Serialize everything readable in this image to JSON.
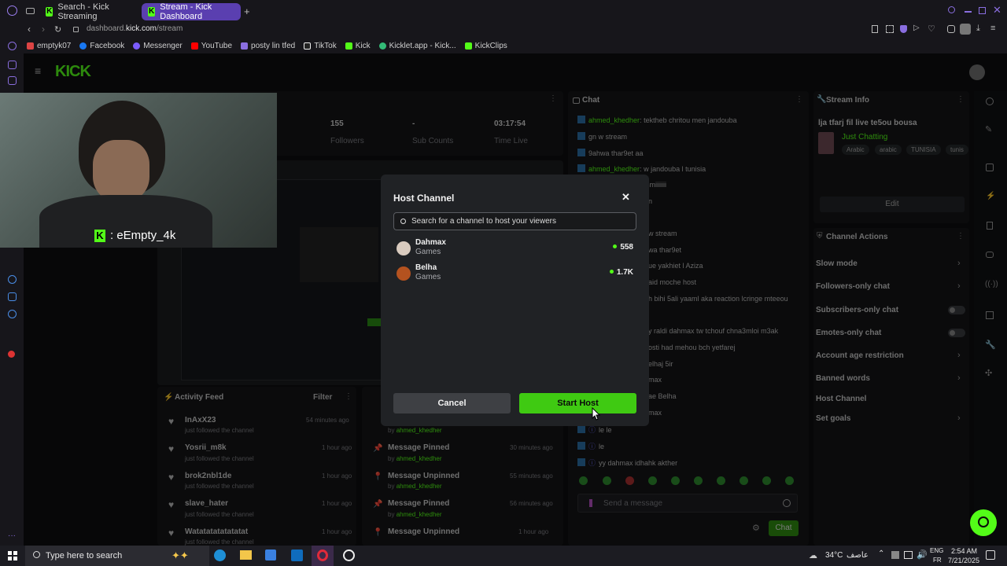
{
  "browser": {
    "tabs": [
      {
        "label": "Search - Kick Streaming",
        "active": false
      },
      {
        "label": "Stream - Kick Dashboard",
        "active": true
      }
    ],
    "url_host": "dashboard.",
    "url_domain": "kick.com",
    "url_path": "/stream",
    "bookmarks": [
      "emptyk07",
      "Facebook",
      "Messenger",
      "YouTube",
      "posty lin tfed",
      "TikTok",
      "Kick",
      "Kicklet.app - Kick...",
      "KickClips"
    ]
  },
  "dashboard": {
    "logo": "KICK",
    "stats": [
      {
        "value": "155",
        "label": "Followers"
      },
      {
        "value": "-",
        "label": "Sub Counts"
      },
      {
        "value": "03:17:54",
        "label": "Time Live"
      }
    ],
    "webcam_overlay": ": eEmpty_4k",
    "chat": {
      "title": "Chat",
      "lines": [
        {
          "user": "ahmed_khedher",
          "text": "tektheb chritou men jandouba"
        },
        {
          "user": "",
          "text": "gn w stream"
        },
        {
          "user": "",
          "text": "9ahwa thar9et aa"
        },
        {
          "user": "ahmed_khedher",
          "text": "w jandouba l tunisia"
        },
        {
          "user": "",
          "text": "rsmiiiiiii"
        },
        {
          "user": "",
          "text": "n"
        },
        {
          "user": "",
          "text": "w stream"
        },
        {
          "user": "",
          "text": "wa thar9et"
        },
        {
          "user": "",
          "text": "ue yakhiet l Aziza"
        },
        {
          "user": "",
          "text": "aid moche host"
        },
        {
          "user": "",
          "text": "h bihi 5ali yaaml aka reaction lcringe mteeou"
        },
        {
          "user": "",
          "text": "y raldi dahmax tw tchouf chna3mloi m3ak"
        },
        {
          "user": "",
          "text": "osti had mehou bch yetfarej"
        },
        {
          "user": "",
          "text": "elhaj 5ir"
        },
        {
          "user": "",
          "text": "max"
        },
        {
          "user": "",
          "text": "ae Belha"
        },
        {
          "user": "",
          "text": "max"
        },
        {
          "user": "",
          "text": "le le"
        },
        {
          "user": "",
          "text": "le"
        },
        {
          "user": "",
          "text": "yy dahmax idhahk akther"
        }
      ],
      "input_placeholder": "Send a message",
      "send_label": "Chat"
    },
    "stream_info": {
      "title": "Stream Info",
      "stream_title": "lja tfarj fil live te5ou bousa",
      "category": "Just Chatting",
      "tags": [
        "Arabic",
        "arabic",
        "TUNISIA",
        "tunis"
      ],
      "edit_label": "Edit"
    },
    "channel_actions": {
      "title": "Channel Actions",
      "items": [
        {
          "label": "Slow mode",
          "kind": "chevron"
        },
        {
          "label": "Followers-only chat",
          "kind": "chevron"
        },
        {
          "label": "Subscribers-only chat",
          "kind": "toggle"
        },
        {
          "label": "Emotes-only chat",
          "kind": "toggle"
        },
        {
          "label": "Account age restriction",
          "kind": "chevron"
        },
        {
          "label": "Banned words",
          "kind": "chevron"
        },
        {
          "label": "Host Channel",
          "kind": "none"
        },
        {
          "label": "Set goals",
          "kind": "chevron"
        }
      ]
    },
    "activity_feed": {
      "title": "Activity Feed",
      "filter_label": "Filter",
      "items": [
        {
          "name": "InAxX23",
          "sub": "just followed the channel",
          "time": "54 minutes ago"
        },
        {
          "name": "Yosrii_m8k",
          "sub": "just followed the channel",
          "time": "1 hour ago"
        },
        {
          "name": "brok2nbl1de",
          "sub": "just followed the channel",
          "time": "1 hour ago"
        },
        {
          "name": "slave_hater",
          "sub": "just followed the channel",
          "time": "1 hour ago"
        },
        {
          "name": "Watatatatatatatat",
          "sub": "just followed the channel",
          "time": "1 hour ago"
        }
      ]
    },
    "mod_log": {
      "items": [
        {
          "name": "",
          "sub_prefix": "by",
          "user": "ahmed_khedher",
          "time": ""
        },
        {
          "name": "Message Pinned",
          "sub_prefix": "by",
          "user": "ahmed_khedher",
          "time": "30 minutes ago"
        },
        {
          "name": "Message Unpinned",
          "sub_prefix": "by",
          "user": "ahmed_khedher",
          "time": "55 minutes ago"
        },
        {
          "name": "Message Pinned",
          "sub_prefix": "by",
          "user": "ahmed_khedher",
          "time": "56 minutes ago"
        },
        {
          "name": "Message Unpinned",
          "sub_prefix": "",
          "user": "",
          "time": "1 hour ago"
        }
      ]
    }
  },
  "modal": {
    "title": "Host Channel",
    "search_placeholder": "Search for a channel to host your viewers",
    "channels": [
      {
        "name": "Dahmax",
        "category": "Games",
        "viewers": "558"
      },
      {
        "name": "Belha",
        "category": "Games",
        "viewers": "1.7K"
      }
    ],
    "cancel_label": "Cancel",
    "start_label": "Start Host"
  },
  "taskbar": {
    "search_placeholder": "Type here to search",
    "weather": "34°C",
    "weather_desc": "عاصف",
    "lang_top": "ENG",
    "lang_bottom": "FR",
    "time": "2:54 AM",
    "date": "7/21/2025"
  },
  "colors": {
    "accent": "#53fc18",
    "modal_bg": "#202225",
    "page_bg": "#0d0e10"
  }
}
